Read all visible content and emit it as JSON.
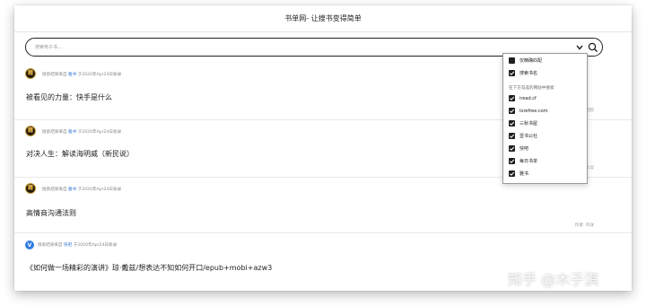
{
  "header": {
    "title": "书单网- 让搜书变得简单"
  },
  "search": {
    "placeholder": "搜索电子书..."
  },
  "results": [
    {
      "avatar_text": "籍",
      "meta_prefix": "搜索结果来自",
      "source": "雅书",
      "meta_suffix": "于2020年Apr24日收录",
      "title": "被看见的力量：快手是什么",
      "author": "作者: 快手研究院"
    },
    {
      "avatar_text": "籍",
      "meta_prefix": "搜索结果来自",
      "source": "雅书",
      "meta_suffix": "于2020年Apr24日收录",
      "title": "对决人生：解读海明威（新民说）",
      "author": "作者: 陈众议"
    },
    {
      "avatar_text": "籍",
      "meta_prefix": "搜索结果来自",
      "source": "雅书",
      "meta_suffix": "于2020年Apr24日收录",
      "title": "高情商沟通法则",
      "author": "作者: 内详"
    },
    {
      "avatar_text": "V",
      "meta_prefix": "搜索结果来自",
      "source": "快吧",
      "meta_suffix": "于2020年Apr24日收录",
      "title": "《如何做一场精彩的演讲》琼·戴兹/想表达不知如何开口/epub+mobi+azw3",
      "author": ""
    }
  ],
  "dropdown": {
    "exact_match": "仅精确匹配",
    "search_title": "搜索书名",
    "section_label": "在下方勾选的网站中搜索",
    "sites": [
      "iread.cf",
      "lorefree.com",
      "三秋书屋",
      "壹书公社",
      "快吧",
      "每日书单",
      "雅书"
    ]
  },
  "watermark": "知乎 @木子淇",
  "colors": {
    "accent": "#3a7bd5",
    "avatar_gold": "#e9b84a",
    "checkbox": "#1f1f1f"
  }
}
